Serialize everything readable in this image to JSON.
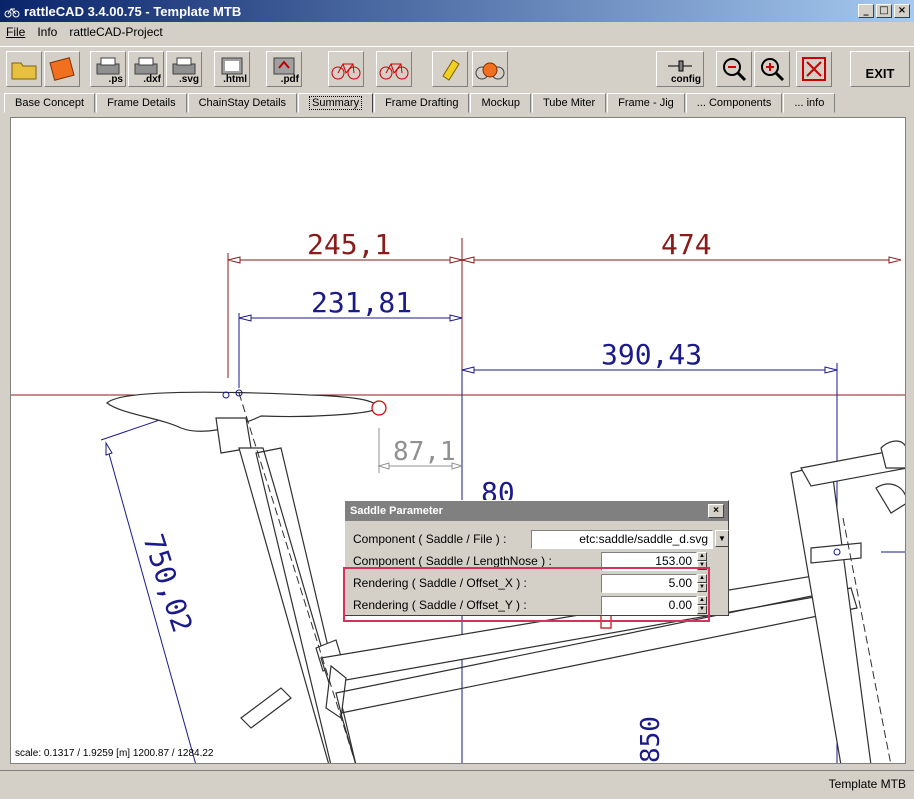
{
  "title": "rattleCAD  3.4.00.75 - Template MTB",
  "window_buttons": [
    "_",
    "□",
    "×"
  ],
  "menu": [
    "File",
    "Info",
    "rattleCAD-Project"
  ],
  "toolbar": {
    "buttons": [
      {
        "name": "open-folder",
        "icon": "folder-icon",
        "caption": ""
      },
      {
        "name": "save",
        "icon": "save-icon",
        "caption": ""
      },
      {
        "name": "export-ps",
        "icon": "printer-icon",
        "caption": ".ps"
      },
      {
        "name": "export-dxf",
        "icon": "printer-icon",
        "caption": ".dxf"
      },
      {
        "name": "export-svg",
        "icon": "printer-icon",
        "caption": ".svg"
      },
      {
        "name": "export-html",
        "icon": "html-icon",
        "caption": ".html"
      },
      {
        "name": "export-pdf",
        "icon": "pdf-icon",
        "caption": ".pdf"
      },
      {
        "name": "bike-view-1",
        "icon": "bike-icon",
        "caption": ""
      },
      {
        "name": "bike-view-2",
        "icon": "bike-icon",
        "caption": ""
      },
      {
        "name": "clear",
        "icon": "eraser-icon",
        "caption": ""
      },
      {
        "name": "bike-render",
        "icon": "bike-render-icon",
        "caption": ""
      },
      {
        "name": "config",
        "icon": "config-icon",
        "caption": "config"
      },
      {
        "name": "zoom-out",
        "icon": "zoom-out-icon",
        "caption": ""
      },
      {
        "name": "zoom-in",
        "icon": "zoom-in-icon",
        "caption": ""
      },
      {
        "name": "fit",
        "icon": "fit-icon",
        "caption": ""
      },
      {
        "name": "exit",
        "icon": "",
        "caption": "EXIT"
      }
    ]
  },
  "tabs": [
    "Base Concept",
    "Frame Details",
    "ChainStay Details",
    "Summary",
    "Frame Drafting",
    "Mockup",
    "Tube Miter",
    "Frame - Jig",
    "... Components",
    "... info"
  ],
  "active_tab": "Summary",
  "drawing": {
    "dims": {
      "d1": "245,1",
      "d2": "474",
      "d3": "231,81",
      "d4": "390,43",
      "d5": "87,1",
      "d6": "750,02",
      "d7": "80",
      "d8": "850"
    },
    "scale_text": "scale: 0.1317 / 1.9259  [m]  1200.87 / 1284.22"
  },
  "dialog": {
    "title": "Saddle Parameter",
    "close": "×",
    "rows": [
      {
        "label": "Component ( Saddle / File ) :",
        "value": "etc:saddle/saddle_d.svg"
      },
      {
        "label": "Component ( Saddle / LengthNose ) :",
        "value": "153.00"
      },
      {
        "label": "Rendering ( Saddle / Offset_X ) :",
        "value": "5.00"
      },
      {
        "label": "Rendering ( Saddle / Offset_Y ) :",
        "value": "0.00"
      }
    ]
  },
  "status": "Template MTB",
  "colors": {
    "dim_red": "#8b1a1a",
    "dim_blue": "#1a1a8b",
    "highlight": "#d8325a"
  }
}
